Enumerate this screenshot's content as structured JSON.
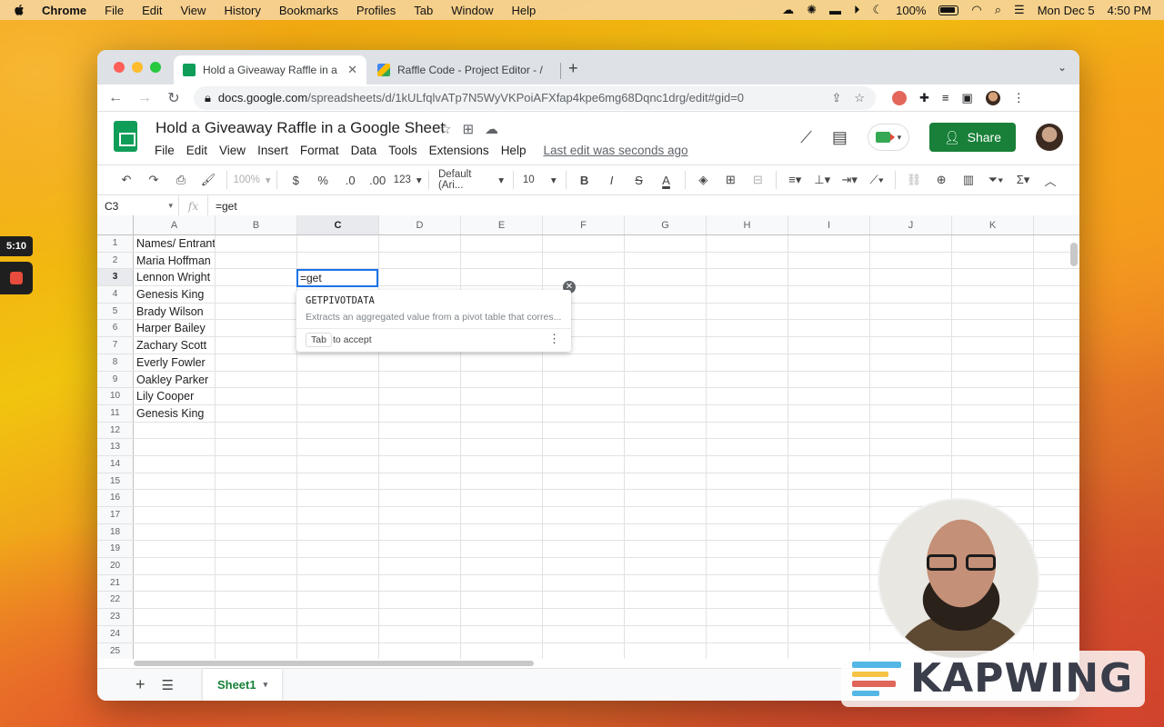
{
  "macos_menu": {
    "app": "Chrome",
    "items": [
      "File",
      "Edit",
      "View",
      "History",
      "Bookmarks",
      "Profiles",
      "Tab",
      "Window",
      "Help"
    ],
    "battery": "100%",
    "date": "Mon Dec 5",
    "time": "4:50 PM"
  },
  "recorder": {
    "elapsed": "5:10"
  },
  "browser": {
    "tabs": [
      {
        "title": "Hold a Giveaway Raffle in a Goo",
        "icon": "sheets-icon",
        "active": true
      },
      {
        "title": "Raffle Code - Project Editor - /",
        "icon": "apps-script-icon",
        "active": false
      }
    ],
    "url_host": "docs.google.com",
    "url_path": "/spreadsheets/d/1kULfqlvATp7N5WyVKPoiAFXfap4kpe6mg68Dqnc1drg/edit#gid=0"
  },
  "doc": {
    "title": "Hold a Giveaway Raffle in a Google Sheet",
    "menus": [
      "File",
      "Edit",
      "View",
      "Insert",
      "Format",
      "Data",
      "Tools",
      "Extensions",
      "Help"
    ],
    "last_edit": "Last edit was seconds ago",
    "share_label": "Share"
  },
  "toolbar": {
    "zoom": "100%",
    "currency": "$",
    "percent": "%",
    "decrease_decimal": ".0",
    "increase_decimal": ".00",
    "more_formats": "123",
    "font": "Default (Ari...",
    "font_size": "10",
    "bold": "B",
    "italic": "I",
    "strike": "S",
    "text_color": "A"
  },
  "formula_bar": {
    "cell_ref": "C3",
    "fx": "fx",
    "formula": "=get"
  },
  "grid": {
    "columns": [
      "A",
      "B",
      "C",
      "D",
      "E",
      "F",
      "G",
      "H",
      "I",
      "J",
      "K"
    ],
    "selected_column": "C",
    "selected_row": 3,
    "rows": [
      "Names/ Entrant",
      "Maria Hoffman",
      "Lennon Wright",
      "Genesis King",
      "Brady Wilson",
      "Harper Bailey",
      "Zachary Scott",
      "Everly Fowler",
      "Oakley Parker",
      "Lily Cooper",
      "Genesis King",
      "",
      "",
      "",
      "",
      "",
      "",
      "",
      "",
      "",
      "",
      "",
      "",
      "",
      ""
    ],
    "active_cell_value": "=get"
  },
  "autocomplete": {
    "function_name": "GETPIVOTDATA",
    "description": "Extracts an aggregated value from a pivot table that corres...",
    "key": "Tab",
    "accept_label": "to accept"
  },
  "sheet_tabs": {
    "active": "Sheet1"
  },
  "watermark": {
    "brand": "KAPWING",
    "colors": [
      "#54b7e6",
      "#f6c344",
      "#e0655a",
      "#54b7e6"
    ]
  },
  "colors": {
    "sheets_green": "#0f9d58",
    "share_green": "#188038",
    "selection_blue": "#1a73e8"
  }
}
